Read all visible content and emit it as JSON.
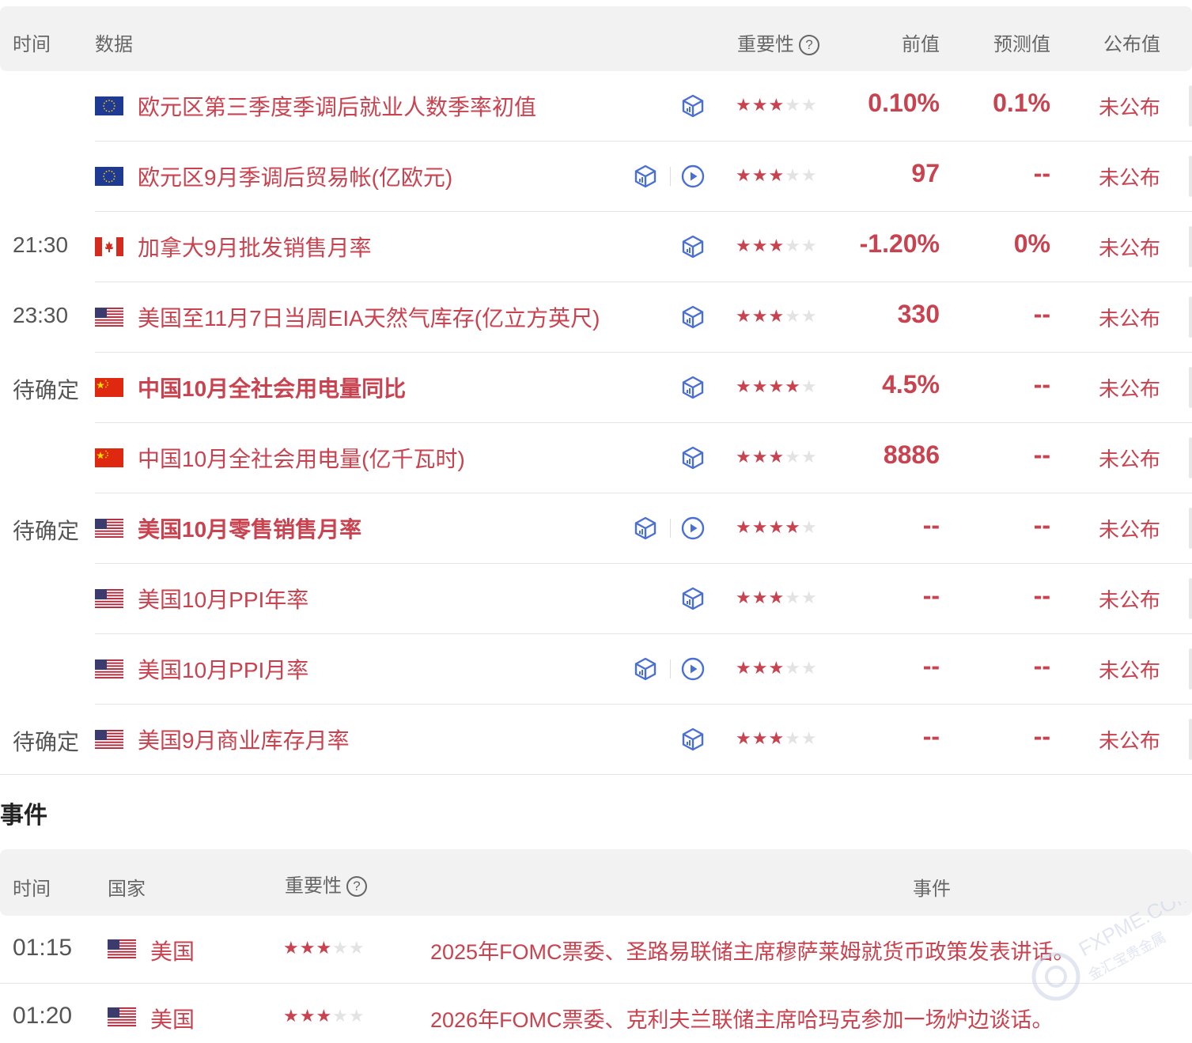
{
  "data_table": {
    "headers": {
      "time": "时间",
      "data": "数据",
      "importance": "重要性",
      "previous": "前值",
      "forecast": "预测值",
      "published": "公布值"
    },
    "help_icon": "?",
    "rows": [
      {
        "time": "",
        "flag": "eu",
        "name": "欧元区第三季度季调后就业人数季率初值",
        "bold": false,
        "video": false,
        "stars": 3,
        "stars_on": "★★★",
        "stars_off": "★★",
        "previous": "0.10%",
        "forecast": "0.1%",
        "published": "未公布"
      },
      {
        "time": "",
        "flag": "eu",
        "name": "欧元区9月季调后贸易帐(亿欧元)",
        "bold": false,
        "video": true,
        "stars": 3,
        "stars_on": "★★★",
        "stars_off": "★★",
        "previous": "97",
        "forecast": "--",
        "published": "未公布"
      },
      {
        "time": "21:30",
        "flag": "ca",
        "name": "加拿大9月批发销售月率",
        "bold": false,
        "video": false,
        "stars": 3,
        "stars_on": "★★★",
        "stars_off": "★★",
        "previous": "-1.20%",
        "forecast": "0%",
        "published": "未公布"
      },
      {
        "time": "23:30",
        "flag": "us",
        "name": "美国至11月7日当周EIA天然气库存(亿立方英尺)",
        "bold": false,
        "video": false,
        "stars": 3,
        "stars_on": "★★★",
        "stars_off": "★★",
        "previous": "330",
        "forecast": "--",
        "published": "未公布"
      },
      {
        "time": "待确定",
        "flag": "cn",
        "name": "中国10月全社会用电量同比",
        "bold": true,
        "video": false,
        "stars": 4,
        "stars_on": "★★★★",
        "stars_off": "★",
        "previous": "4.5%",
        "forecast": "--",
        "published": "未公布"
      },
      {
        "time": "",
        "flag": "cn",
        "name": "中国10月全社会用电量(亿千瓦时)",
        "bold": false,
        "video": false,
        "stars": 3,
        "stars_on": "★★★",
        "stars_off": "★★",
        "previous": "8886",
        "forecast": "--",
        "published": "未公布"
      },
      {
        "time": "待确定",
        "flag": "us",
        "name": "美国10月零售销售月率",
        "bold": true,
        "video": true,
        "stars": 4,
        "stars_on": "★★★★",
        "stars_off": "★",
        "previous": "--",
        "forecast": "--",
        "published": "未公布"
      },
      {
        "time": "",
        "flag": "us",
        "name": "美国10月PPI年率",
        "bold": false,
        "video": false,
        "stars": 3,
        "stars_on": "★★★",
        "stars_off": "★★",
        "previous": "--",
        "forecast": "--",
        "published": "未公布"
      },
      {
        "time": "",
        "flag": "us",
        "name": "美国10月PPI月率",
        "bold": false,
        "video": true,
        "stars": 3,
        "stars_on": "★★★",
        "stars_off": "★★",
        "previous": "--",
        "forecast": "--",
        "published": "未公布"
      },
      {
        "time": "待确定",
        "flag": "us",
        "name": "美国9月商业库存月率",
        "bold": false,
        "video": false,
        "stars": 3,
        "stars_on": "★★★",
        "stars_off": "★★",
        "previous": "--",
        "forecast": "--",
        "published": "未公布"
      }
    ]
  },
  "events": {
    "title": "事件",
    "headers": {
      "time": "时间",
      "country": "国家",
      "importance": "重要性",
      "event": "事件"
    },
    "help_icon": "?",
    "rows": [
      {
        "time": "01:15",
        "flag": "us",
        "country": "美国",
        "stars": 3,
        "stars_on": "★★★",
        "stars_off": "★★",
        "text": "2025年FOMC票委、圣路易联储主席穆萨莱姆就货币政策发表讲话。"
      },
      {
        "time": "01:20",
        "flag": "us",
        "country": "美国",
        "stars": 3,
        "stars_on": "★★★",
        "stars_off": "★★",
        "text": "2026年FOMC票委、克利夫兰联储主席哈玛克参加一场炉边谈话。"
      }
    ]
  },
  "watermark": {
    "text": "FXPME.COM",
    "subtext": "金汇宝贵金属"
  },
  "colors": {
    "accent_red": "#c8434f",
    "icon_blue": "#4a6fd4",
    "header_bg": "#f2f2f2",
    "star_off": "#e3e3e3"
  },
  "icons": {
    "data_icon": "cube-chart-icon",
    "video_icon": "play-circle-icon",
    "help_icon": "question-circle-icon",
    "star": "star-icon"
  }
}
